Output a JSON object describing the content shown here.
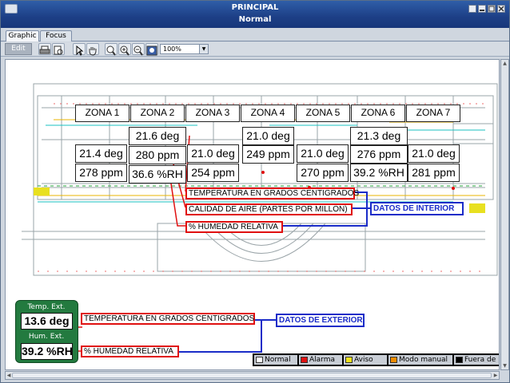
{
  "window": {
    "title": "PRINCIPAL",
    "subtitle": "Normal"
  },
  "tabs": [
    {
      "label": "Graphic"
    },
    {
      "label": "Focus"
    }
  ],
  "toolbar": {
    "edit_label": "Edit",
    "zoom": "100%"
  },
  "zones": [
    {
      "name": "ZONA 1",
      "values": [
        "21.4 deg",
        "278 ppm"
      ]
    },
    {
      "name": "ZONA 2",
      "values": [
        "21.6 deg",
        "280 ppm",
        "36.6 %RH"
      ]
    },
    {
      "name": "ZONA 3",
      "values": [
        "21.0 deg",
        "254 ppm"
      ]
    },
    {
      "name": "ZONA 4",
      "values": [
        "21.0 deg",
        "249 ppm"
      ]
    },
    {
      "name": "ZONA 5",
      "values": [
        "21.0 deg",
        "270 ppm"
      ]
    },
    {
      "name": "ZONA 6",
      "values": [
        "21.3 deg",
        "276 ppm",
        "39.2 %RH"
      ]
    },
    {
      "name": "ZONA 7",
      "values": [
        "21.0 deg",
        "281 ppm"
      ]
    }
  ],
  "interior_labels": {
    "temperature": "TEMPERATURA EN GRADOS CENTIGRADOS",
    "air_quality": "CALIDAD DE AIRE (PARTES POR MILLON)",
    "humidity": "% HUMEDAD RELATIVA",
    "group": "DATOS DE INTERIOR"
  },
  "exterior": {
    "temp_caption": "Temp. Ext.",
    "temp_value": "13.6 deg",
    "hum_caption": "Hum. Ext.",
    "hum_value": "39.2 %RH",
    "temperature_label": "TEMPERATURA EN GRADOS CENTIGRADOS",
    "humidity_label": "% HUMEDAD RELATIVA",
    "group": "DATOS DE EXTERIOR"
  },
  "legend": [
    {
      "label": "Normal",
      "color": "#ffffff"
    },
    {
      "label": "Alarma",
      "color": "#e01010"
    },
    {
      "label": "Aviso",
      "color": "#f2e21b"
    },
    {
      "label": "Modo manual",
      "color": "#f08c00"
    },
    {
      "label": "Fuera de",
      "color": "#000000"
    }
  ]
}
